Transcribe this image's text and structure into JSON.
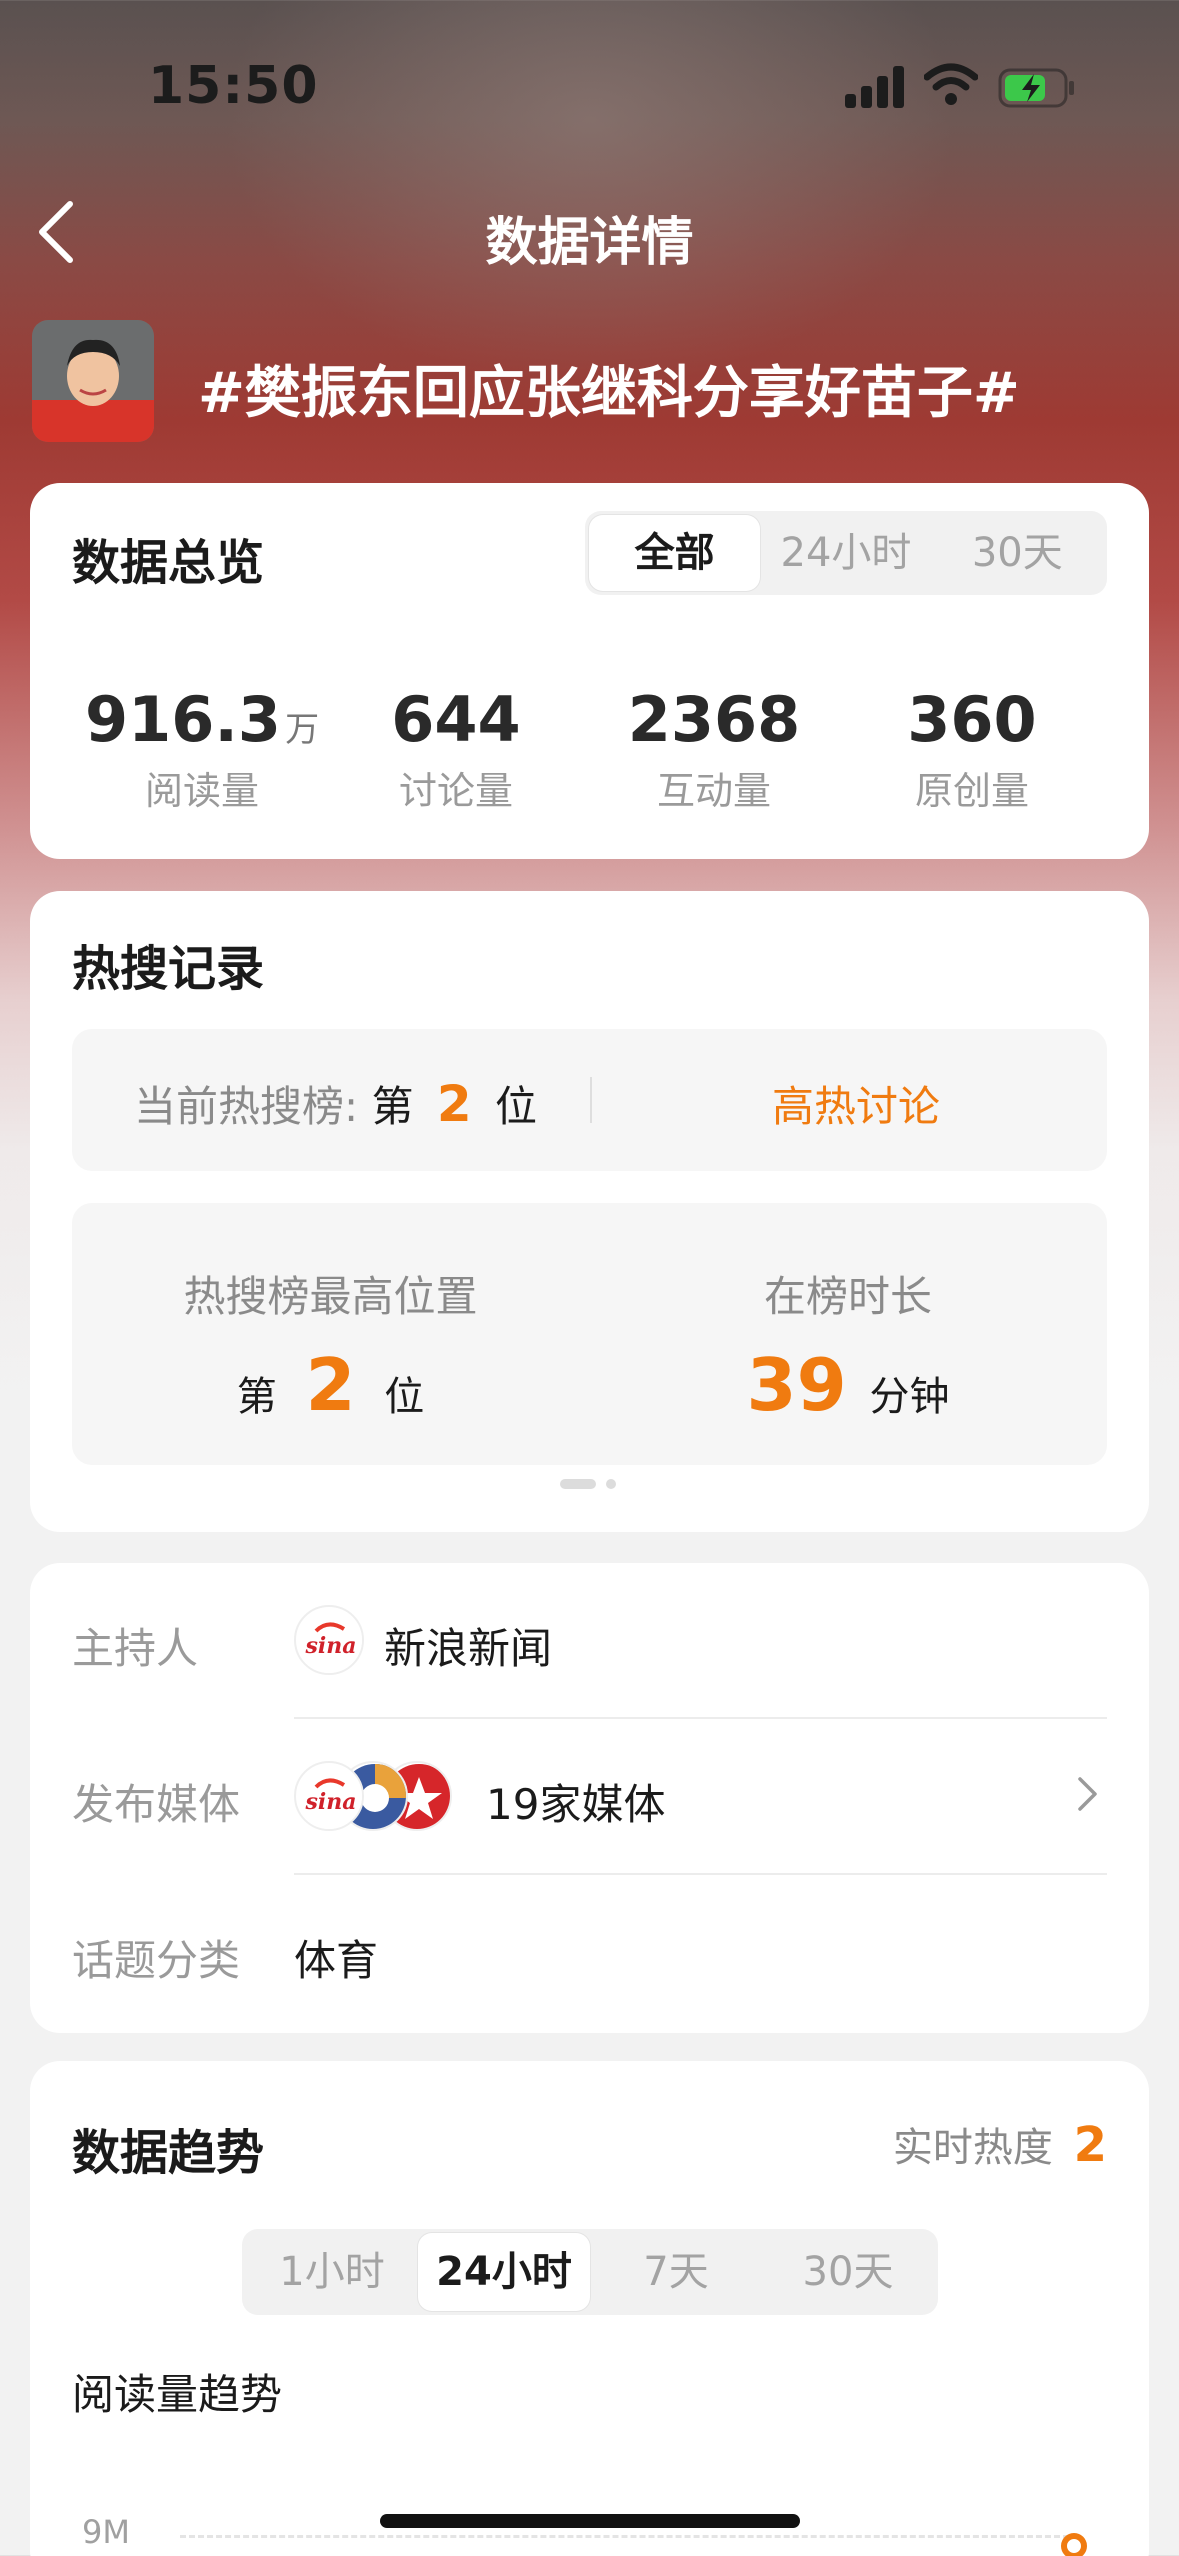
{
  "status_bar": {
    "time": "15:50"
  },
  "nav": {
    "title": "数据详情"
  },
  "topic": {
    "title": "#樊振东回应张继科分享好苗子#"
  },
  "overview": {
    "heading": "数据总览",
    "tabs": [
      "全部",
      "24小时",
      "30天"
    ],
    "stats": [
      {
        "value": "916.3",
        "unit": "万",
        "label": "阅读量"
      },
      {
        "value": "644",
        "unit": "",
        "label": "讨论量"
      },
      {
        "value": "2368",
        "unit": "",
        "label": "互动量"
      },
      {
        "value": "360",
        "unit": "",
        "label": "原创量"
      }
    ]
  },
  "hot_search": {
    "heading": "热搜记录",
    "current_label": "当前热搜榜:",
    "current_prefix": "第",
    "current_rank": "2",
    "current_suffix": "位",
    "tag": "高热讨论",
    "highest_label": "热搜榜最高位置",
    "highest_prefix": "第",
    "highest_rank": "2",
    "highest_suffix": "位",
    "duration_label": "在榜时长",
    "duration_value": "39",
    "duration_unit": "分钟"
  },
  "info": {
    "host_key": "主持人",
    "host_value": "新浪新闻",
    "media_key": "发布媒体",
    "media_value": "19家媒体",
    "category_key": "话题分类",
    "category_value": "体育"
  },
  "trend": {
    "heading": "数据趋势",
    "realtime_label": "实时热度",
    "realtime_value": "2",
    "tabs": [
      "1小时",
      "24小时",
      "7天",
      "30天"
    ],
    "chart_title": "阅读量趋势",
    "y_tick_top": "9M"
  },
  "colors": {
    "accent": "#f07b10",
    "card": "#ffffff"
  }
}
